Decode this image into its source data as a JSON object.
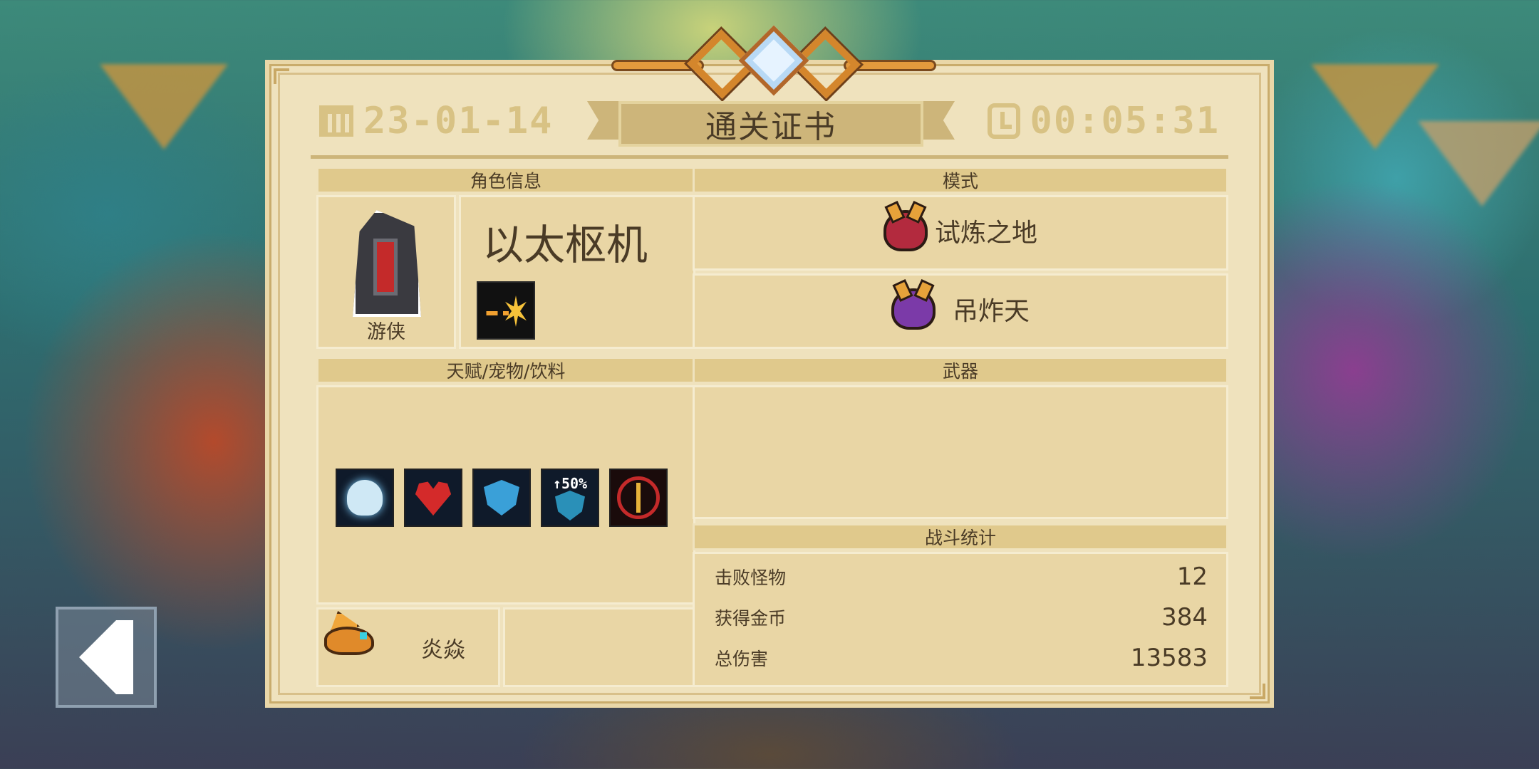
{
  "certificate": {
    "title": "通关证书",
    "date": "23-01-14",
    "time": "00:05:31"
  },
  "sections": {
    "character_info": "角色信息",
    "mode": "模式",
    "talents_pets_drinks": "天赋/宠物/饮料",
    "weapons": "武器",
    "battle_stats": "战斗统计"
  },
  "character": {
    "class_name": "游侠",
    "player_name": "以太枢机",
    "skill_icon": "lightning-burst-skill-icon"
  },
  "modes": [
    {
      "label": "试炼之地",
      "icon": "red-demon-helmet-icon"
    },
    {
      "label": "吊炸天",
      "icon": "purple-demon-helmet-icon"
    }
  ],
  "buffs": [
    {
      "icon": "meditating-monk-icon"
    },
    {
      "icon": "heart-plus-icon"
    },
    {
      "icon": "shield-plus-icon"
    },
    {
      "icon": "shield-boost-icon",
      "text": "↑50%"
    },
    {
      "icon": "golden-sword-icon"
    }
  ],
  "pet": {
    "name": "炎焱",
    "icon": "orange-dragon-pet-icon"
  },
  "stats": [
    {
      "label": "击败怪物",
      "value": "12"
    },
    {
      "label": "获得金币",
      "value": "384"
    },
    {
      "label": "总伤害",
      "value": "13583"
    }
  ],
  "colors": {
    "panel": "#efe2bd",
    "header": "#e0c98c",
    "text": "#4a3b26",
    "accent_orange": "#e39a3d"
  }
}
